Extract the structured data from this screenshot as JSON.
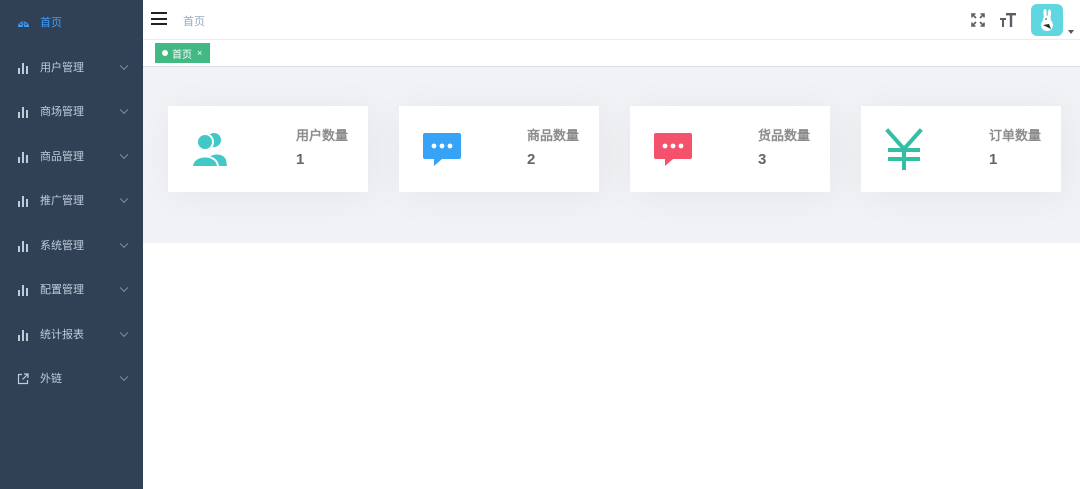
{
  "sidebar": {
    "items": [
      {
        "label": "首页",
        "icon": "dashboard-icon",
        "active": true,
        "has_children": false
      },
      {
        "label": "用户管理",
        "icon": "chart-icon",
        "has_children": true
      },
      {
        "label": "商场管理",
        "icon": "chart-icon",
        "has_children": true
      },
      {
        "label": "商品管理",
        "icon": "chart-icon",
        "has_children": true
      },
      {
        "label": "推广管理",
        "icon": "chart-icon",
        "has_children": true
      },
      {
        "label": "系统管理",
        "icon": "chart-icon",
        "has_children": true
      },
      {
        "label": "配置管理",
        "icon": "chart-icon",
        "has_children": true
      },
      {
        "label": "统计报表",
        "icon": "chart-icon",
        "has_children": true
      },
      {
        "label": "外链",
        "icon": "external-link-icon",
        "has_children": true
      }
    ]
  },
  "header": {
    "breadcrumb": "首页",
    "right_icons": [
      "fullscreen-icon",
      "font-size-icon"
    ]
  },
  "tags": [
    {
      "label": "首页",
      "close": "×",
      "active": true
    }
  ],
  "cards": [
    {
      "title": "用户数量",
      "value": "1",
      "icon": "users-icon",
      "color": "#40c9c6"
    },
    {
      "title": "商品数量",
      "value": "2",
      "icon": "message-icon",
      "color": "#36a3f7"
    },
    {
      "title": "货品数量",
      "value": "3",
      "icon": "message-icon",
      "color": "#f4516c"
    },
    {
      "title": "订单数量",
      "value": "1",
      "icon": "yen-icon",
      "color": "#34bfa3"
    }
  ],
  "colors": {
    "sidebar_bg": "#304156",
    "sidebar_text": "#bfcbd9",
    "sidebar_active": "#409eff",
    "tag_active": "#42b983",
    "panel_bg": "#f0f2f5"
  }
}
